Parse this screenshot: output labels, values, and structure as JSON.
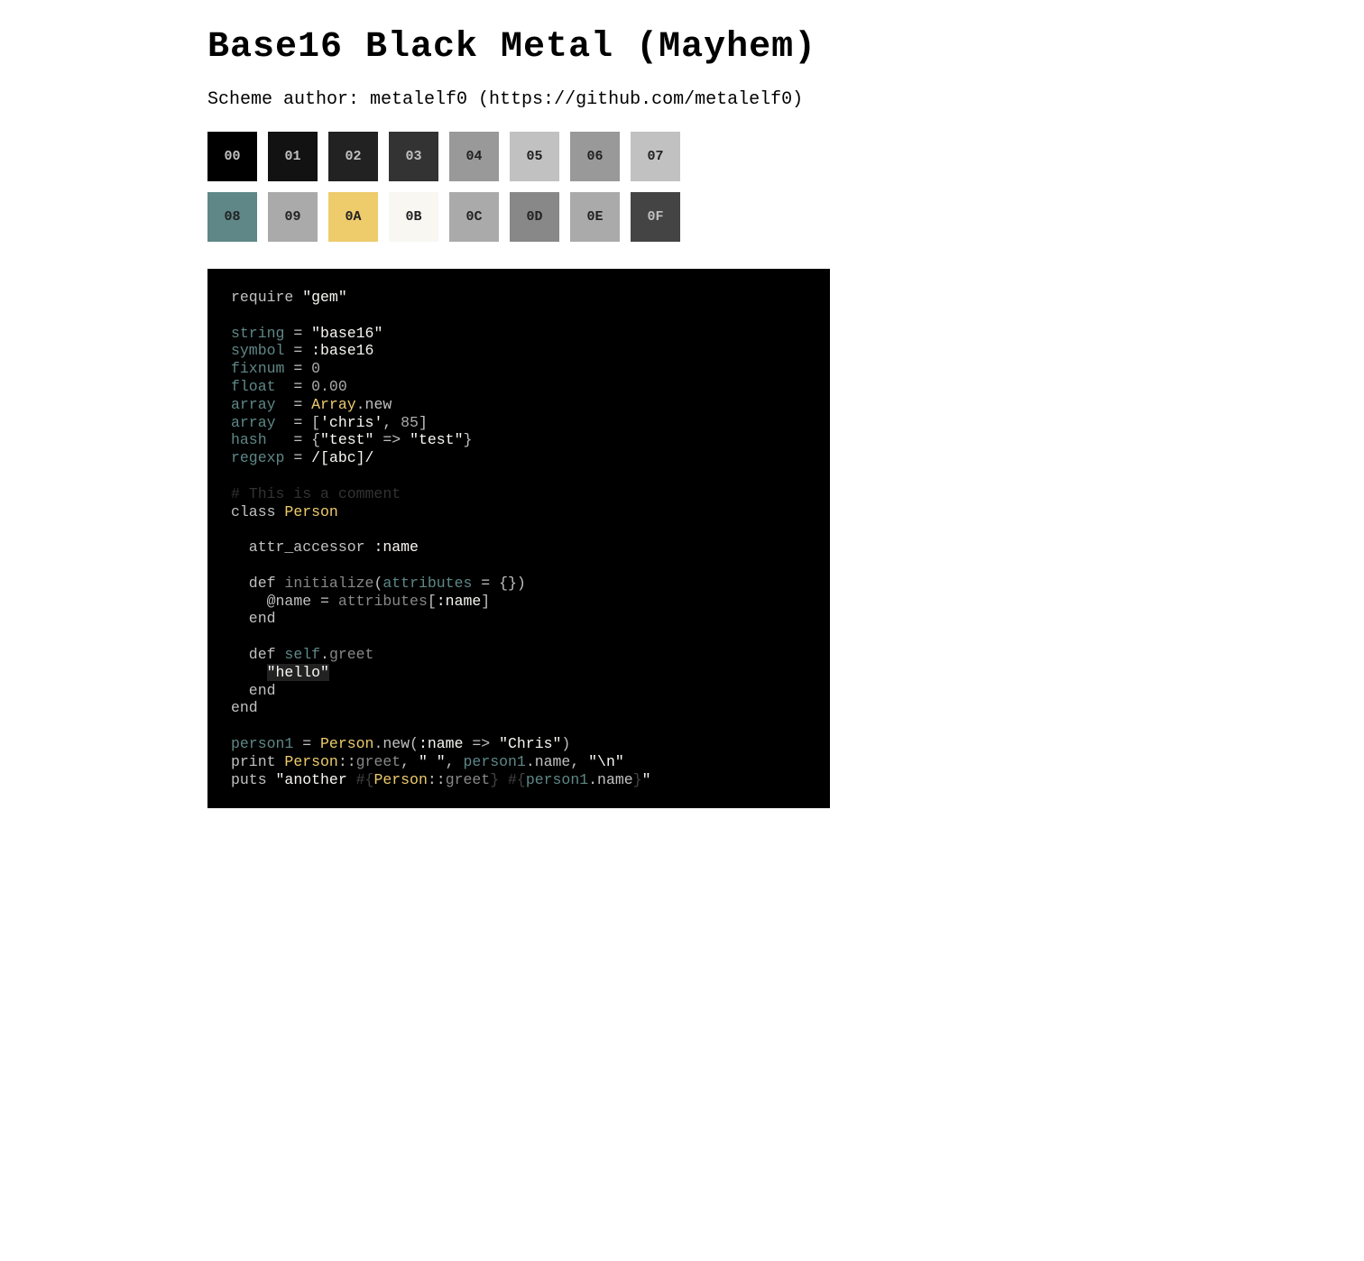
{
  "title": "Base16 Black Metal (Mayhem)",
  "author": "Scheme author: metalelf0 (https://github.com/metalelf0)",
  "palette": {
    "base00": "#000000",
    "base01": "#121212",
    "base02": "#222222",
    "base03": "#333333",
    "base04": "#999999",
    "base05": "#c1c1c1",
    "base06": "#999999",
    "base07": "#c1c1c1",
    "base08": "#5f8787",
    "base09": "#aaaaaa",
    "base0A": "#eecc6c",
    "base0B": "#f8f7f2",
    "base0C": "#aaaaaa",
    "base0D": "#888888",
    "base0E": "#aaaaaa",
    "base0F": "#444444"
  },
  "swatch_labels": [
    "00",
    "01",
    "02",
    "03",
    "04",
    "05",
    "06",
    "07",
    "08",
    "09",
    "0A",
    "0B",
    "0C",
    "0D",
    "0E",
    "0F"
  ],
  "swatch_label_colors": [
    "#c1c1c1",
    "#c1c1c1",
    "#c1c1c1",
    "#c1c1c1",
    "#222222",
    "#222222",
    "#222222",
    "#222222",
    "#222222",
    "#222222",
    "#222222",
    "#222222",
    "#222222",
    "#222222",
    "#222222",
    "#c1c1c1"
  ],
  "code": {
    "tokens": [
      {
        "t": "require ",
        "c": "base05"
      },
      {
        "t": "\"gem\"",
        "c": "base0B"
      },
      {
        "t": "\n\n",
        "c": "base05"
      },
      {
        "t": "string",
        "c": "base08"
      },
      {
        "t": " = ",
        "c": "base05"
      },
      {
        "t": "\"base16\"",
        "c": "base0B"
      },
      {
        "t": "\n",
        "c": "base05"
      },
      {
        "t": "symbol",
        "c": "base08"
      },
      {
        "t": " = ",
        "c": "base05"
      },
      {
        "t": ":base16",
        "c": "base0B"
      },
      {
        "t": "\n",
        "c": "base05"
      },
      {
        "t": "fixnum",
        "c": "base08"
      },
      {
        "t": " = ",
        "c": "base05"
      },
      {
        "t": "0",
        "c": "base09"
      },
      {
        "t": "\n",
        "c": "base05"
      },
      {
        "t": "float",
        "c": "base08"
      },
      {
        "t": "  = ",
        "c": "base05"
      },
      {
        "t": "0.00",
        "c": "base09"
      },
      {
        "t": "\n",
        "c": "base05"
      },
      {
        "t": "array",
        "c": "base08"
      },
      {
        "t": "  = ",
        "c": "base05"
      },
      {
        "t": "Array",
        "c": "base0A"
      },
      {
        "t": ".new",
        "c": "base05"
      },
      {
        "t": "\n",
        "c": "base05"
      },
      {
        "t": "array",
        "c": "base08"
      },
      {
        "t": "  = [",
        "c": "base05"
      },
      {
        "t": "'chris'",
        "c": "base0B"
      },
      {
        "t": ", ",
        "c": "base05"
      },
      {
        "t": "85",
        "c": "base09"
      },
      {
        "t": "]",
        "c": "base05"
      },
      {
        "t": "\n",
        "c": "base05"
      },
      {
        "t": "hash",
        "c": "base08"
      },
      {
        "t": "   = {",
        "c": "base05"
      },
      {
        "t": "\"test\"",
        "c": "base0B"
      },
      {
        "t": " => ",
        "c": "base05"
      },
      {
        "t": "\"test\"",
        "c": "base0B"
      },
      {
        "t": "}",
        "c": "base05"
      },
      {
        "t": "\n",
        "c": "base05"
      },
      {
        "t": "regexp",
        "c": "base08"
      },
      {
        "t": " = ",
        "c": "base05"
      },
      {
        "t": "/[abc]/",
        "c": "base0B"
      },
      {
        "t": "\n\n",
        "c": "base05"
      },
      {
        "t": "# This is a comment",
        "c": "base03"
      },
      {
        "t": "\n",
        "c": "base05"
      },
      {
        "t": "class ",
        "c": "base05"
      },
      {
        "t": "Person",
        "c": "base0A"
      },
      {
        "t": "\n\n",
        "c": "base05"
      },
      {
        "t": "  attr_accessor ",
        "c": "base05"
      },
      {
        "t": ":name",
        "c": "base0B"
      },
      {
        "t": "\n\n",
        "c": "base05"
      },
      {
        "t": "  def ",
        "c": "base05"
      },
      {
        "t": "initialize",
        "c": "base0D"
      },
      {
        "t": "(",
        "c": "base05"
      },
      {
        "t": "attributes",
        "c": "base08"
      },
      {
        "t": " = {})",
        "c": "base05"
      },
      {
        "t": "\n",
        "c": "base05"
      },
      {
        "t": "    ",
        "c": "base05"
      },
      {
        "t": "@name",
        "c": "base05"
      },
      {
        "t": " = ",
        "c": "base05"
      },
      {
        "t": "attributes",
        "c": "base0D"
      },
      {
        "t": "[",
        "c": "base05"
      },
      {
        "t": ":name",
        "c": "base0B"
      },
      {
        "t": "]",
        "c": "base05"
      },
      {
        "t": "\n",
        "c": "base05"
      },
      {
        "t": "  end",
        "c": "base05"
      },
      {
        "t": "\n\n",
        "c": "base05"
      },
      {
        "t": "  def ",
        "c": "base05"
      },
      {
        "t": "self",
        "c": "base08"
      },
      {
        "t": ".",
        "c": "base05"
      },
      {
        "t": "greet",
        "c": "base0D"
      },
      {
        "t": "\n",
        "c": "base05"
      },
      {
        "t": "    ",
        "c": "base05"
      },
      {
        "t": "\"hello\"",
        "c": "base0B",
        "bg": "base02"
      },
      {
        "t": "\n",
        "c": "base05"
      },
      {
        "t": "  end",
        "c": "base05"
      },
      {
        "t": "\n",
        "c": "base05"
      },
      {
        "t": "end",
        "c": "base05"
      },
      {
        "t": "\n\n",
        "c": "base05"
      },
      {
        "t": "person1",
        "c": "base08"
      },
      {
        "t": " = ",
        "c": "base05"
      },
      {
        "t": "Person",
        "c": "base0A"
      },
      {
        "t": ".new(",
        "c": "base05"
      },
      {
        "t": ":name",
        "c": "base0B"
      },
      {
        "t": " => ",
        "c": "base05"
      },
      {
        "t": "\"Chris\"",
        "c": "base0B"
      },
      {
        "t": ")",
        "c": "base05"
      },
      {
        "t": "\n",
        "c": "base05"
      },
      {
        "t": "print ",
        "c": "base05"
      },
      {
        "t": "Person",
        "c": "base0A"
      },
      {
        "t": "::",
        "c": "base05"
      },
      {
        "t": "greet",
        "c": "base0D"
      },
      {
        "t": ", ",
        "c": "base05"
      },
      {
        "t": "\" \"",
        "c": "base0B"
      },
      {
        "t": ", ",
        "c": "base05"
      },
      {
        "t": "person1",
        "c": "base08"
      },
      {
        "t": ".name, ",
        "c": "base05"
      },
      {
        "t": "\"\\n\"",
        "c": "base0B"
      },
      {
        "t": "\n",
        "c": "base05"
      },
      {
        "t": "puts ",
        "c": "base05"
      },
      {
        "t": "\"another ",
        "c": "base0B"
      },
      {
        "t": "#{",
        "c": "base0F"
      },
      {
        "t": "Person",
        "c": "base0A"
      },
      {
        "t": "::",
        "c": "base05"
      },
      {
        "t": "greet",
        "c": "base0D"
      },
      {
        "t": "}",
        "c": "base0F"
      },
      {
        "t": " ",
        "c": "base0B"
      },
      {
        "t": "#{",
        "c": "base0F"
      },
      {
        "t": "person1",
        "c": "base08"
      },
      {
        "t": ".name",
        "c": "base05"
      },
      {
        "t": "}",
        "c": "base0F"
      },
      {
        "t": "\"",
        "c": "base0B"
      }
    ]
  }
}
